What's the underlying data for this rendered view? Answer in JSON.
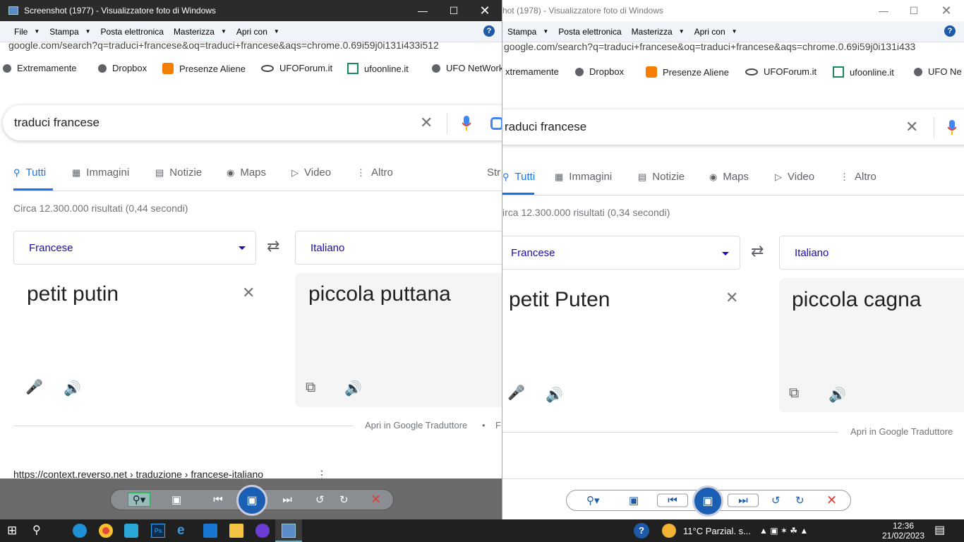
{
  "left": {
    "title": "Screenshot (1977) - Visualizzatore foto di Windows",
    "menu": [
      "File",
      "Stampa",
      "Posta elettronica",
      "Masterizza",
      "Apri con"
    ],
    "help": "?",
    "url": "google.com/search?q=traduci+francese&oq=traduci+francese&aqs=chrome.0.69i59j0i131i433i512",
    "bookmarks": [
      "Extremamente",
      "Dropbox",
      "Presenze Aliene",
      "UFOForum.it",
      "ufoonline.it",
      "UFO NetWork"
    ],
    "query": "traduci francese",
    "tabs": [
      "Tutti",
      "Immagini",
      "Notizie",
      "Maps",
      "Video",
      "Altro",
      "Str"
    ],
    "stats": "Circa 12.300.000 risultati (0,44 secondi)",
    "source_lang": "Francese",
    "target_lang": "Italiano",
    "source_text": "petit putin",
    "translation": "piccola puttana",
    "footer_link": "Apri in Google Traduttore",
    "footer_dot": "•",
    "footer_more": "F",
    "result_cite": "https://context.reverso.net › traduzione › francese-italiano"
  },
  "right": {
    "title": "hot (1978) - Visualizzatore foto di Windows",
    "menu": [
      "Stampa",
      "Posta elettronica",
      "Masterizza",
      "Apri con"
    ],
    "help": "?",
    "url": "google.com/search?q=traduci+francese&oq=traduci+francese&aqs=chrome.0.69i59j0i131i433",
    "bookmarks": [
      "xtremamente",
      "Dropbox",
      "Presenze Aliene",
      "UFOForum.it",
      "ufoonline.it",
      "UFO Ne"
    ],
    "query": "raduci francese",
    "tabs": [
      "Tutti",
      "Immagini",
      "Notizie",
      "Maps",
      "Video",
      "Altro"
    ],
    "stats": "irca 12.300.000 risultati (0,34 secondi)",
    "source_lang": "Francese",
    "target_lang": "Italiano",
    "source_text": "petit Puten",
    "translation": "piccola cagna",
    "footer_link": "Apri in Google Traduttore"
  },
  "taskbar": {
    "weather": "11°C  Parzial. s...",
    "time": "12:36",
    "date": "21/02/2023"
  }
}
